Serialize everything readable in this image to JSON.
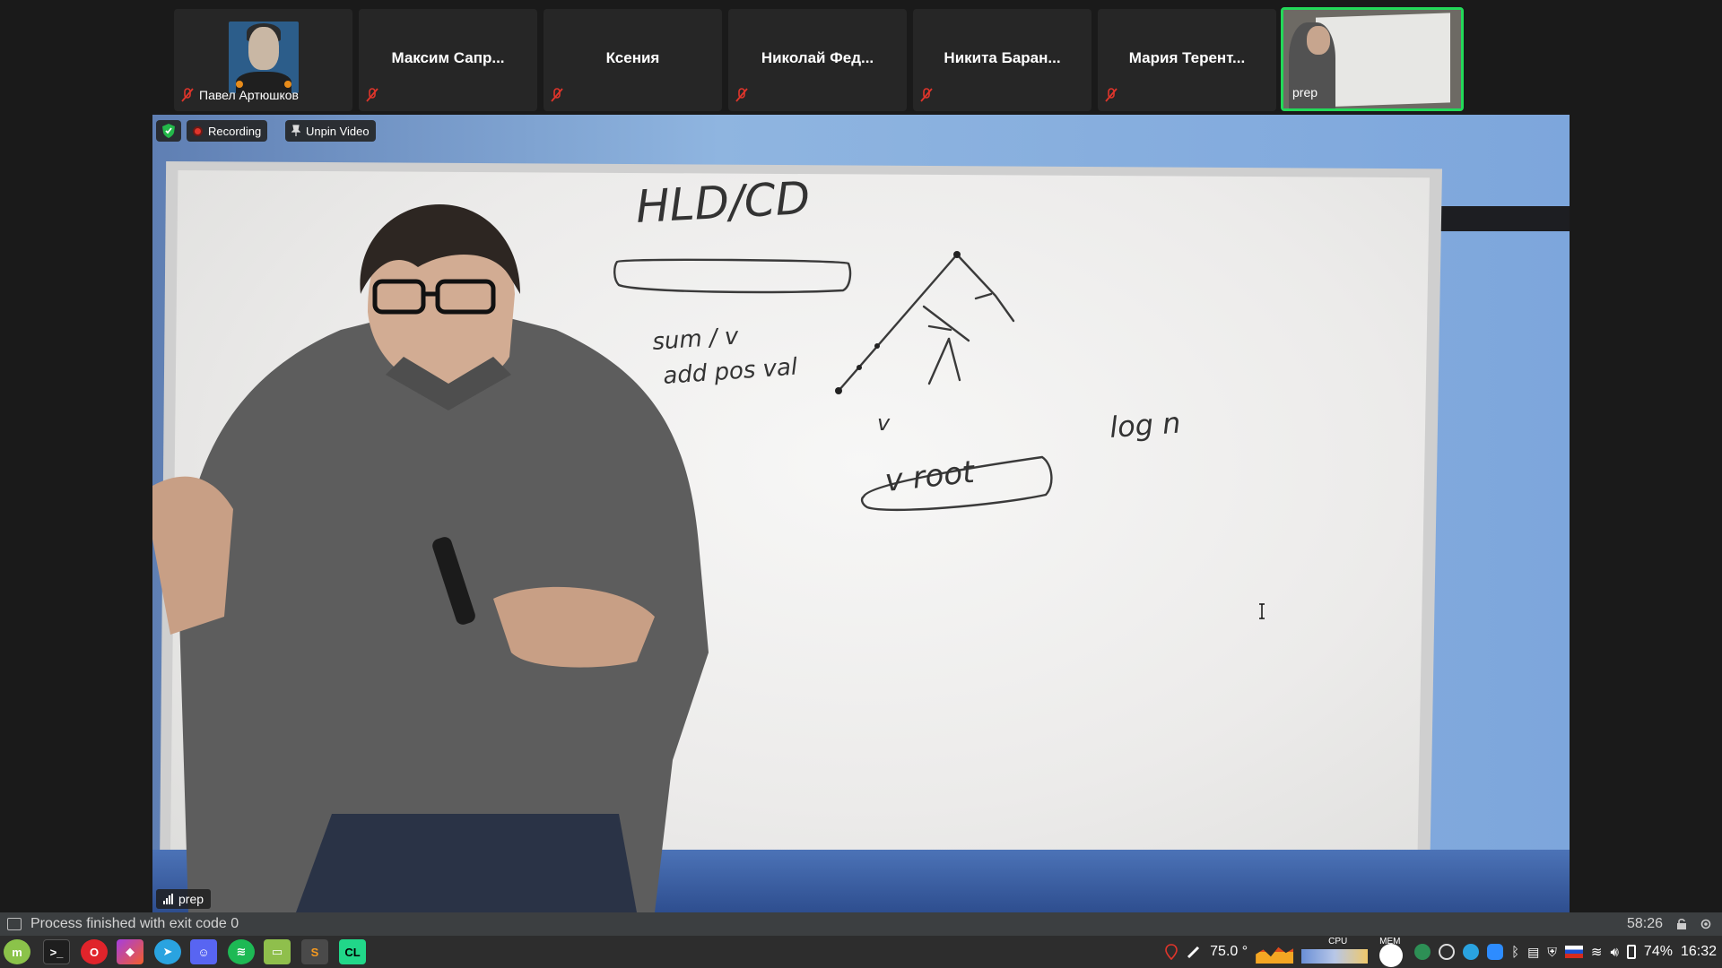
{
  "participants": [
    {
      "name": "Павел Артюшков",
      "muted": true,
      "has_avatar": true
    },
    {
      "name": "Максим Сапр...",
      "muted": true
    },
    {
      "name": "Ксения",
      "muted": false
    },
    {
      "name": "Николай Фед...",
      "muted": true
    },
    {
      "name": "Никита Баран...",
      "muted": true
    },
    {
      "name": "Мария Терент...",
      "muted": true
    },
    {
      "name": "prep",
      "muted": false,
      "active_speaker": true
    }
  ],
  "video": {
    "recording_label": "Recording",
    "unpin_label": "Unpin Video",
    "speaker_label": "prep"
  },
  "whiteboard": {
    "title": "HLD/CD",
    "note_line1": "sum / v",
    "note_line2": "add pos val",
    "root_label": "v  root",
    "log_label": "log n",
    "v_label": "v"
  },
  "statusbar": {
    "message": "Process finished with exit code 0",
    "time": "58:26"
  },
  "taskbar": {
    "apps": [
      {
        "name": "mint-menu",
        "color": "#8bc34a"
      },
      {
        "name": "terminal",
        "color": "#1e1e1e"
      },
      {
        "name": "opera",
        "color": "#e0242b"
      },
      {
        "name": "jetbrains-toolbox",
        "color": "#a53ee0"
      },
      {
        "name": "telegram",
        "color": "#2aa3e0"
      },
      {
        "name": "discord",
        "color": "#5865f2"
      },
      {
        "name": "spotify",
        "color": "#1db954"
      },
      {
        "name": "files",
        "color": "#8fbf4c"
      },
      {
        "name": "sublime",
        "color": "#4a4a4a"
      },
      {
        "name": "clion",
        "color": "#21d789"
      }
    ],
    "temperature": "75.0 °",
    "cpu_label": "CPU",
    "mem_label": "MEM",
    "battery": "74%",
    "clock": "16:32"
  }
}
